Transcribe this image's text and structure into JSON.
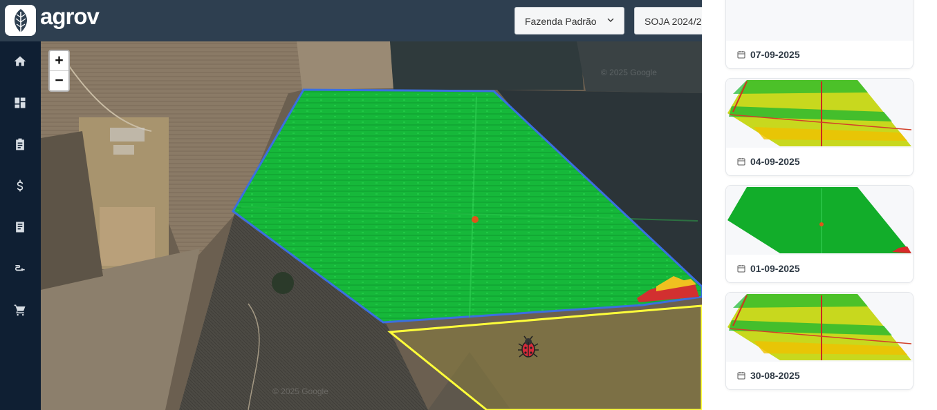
{
  "app": {
    "logo_text": "agrov"
  },
  "header": {
    "farm_select": {
      "value": "Fazenda Padrão"
    },
    "season_select": {
      "value": "SOJA 2024/2"
    }
  },
  "sidebar": {
    "items": [
      {
        "icon": "home-icon"
      },
      {
        "icon": "dashboard-icon"
      },
      {
        "icon": "clipboard-icon"
      },
      {
        "icon": "dollar-icon"
      },
      {
        "icon": "report-icon"
      },
      {
        "icon": "plug-icon"
      },
      {
        "icon": "cart-icon"
      }
    ]
  },
  "map": {
    "zoom_in_label": "+",
    "zoom_out_label": "−",
    "watermark_1": "© 2025 Google",
    "watermark_2": "© 2025 Google",
    "field_border_color": "#3b6fe0",
    "neighbor_border_color": "#ffff3a",
    "pest_marker": "bug-icon"
  },
  "imagery": {
    "cards": [
      {
        "date": "07-09-2025",
        "thumbnail": "empty"
      },
      {
        "date": "04-09-2025",
        "thumbnail": "ndvi-mixed"
      },
      {
        "date": "01-09-2025",
        "thumbnail": "ndvi-green"
      },
      {
        "date": "30-08-2025",
        "thumbnail": "ndvi-mixed"
      }
    ]
  }
}
